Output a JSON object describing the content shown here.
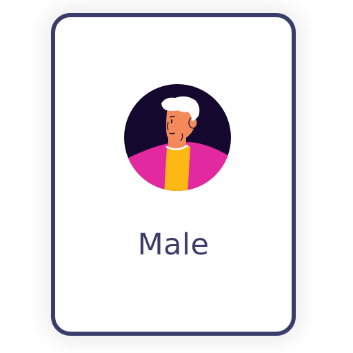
{
  "option_card": {
    "label": "Male",
    "avatar_icon": "male-avatar-icon",
    "colors": {
      "border": "#3a3d6b",
      "label": "#3a3d6b",
      "avatar_background": "#14082e",
      "jacket": "#e2299f",
      "shirt": "#fdb813",
      "skin": "#f48a5c",
      "hair": "#ffffff"
    }
  }
}
